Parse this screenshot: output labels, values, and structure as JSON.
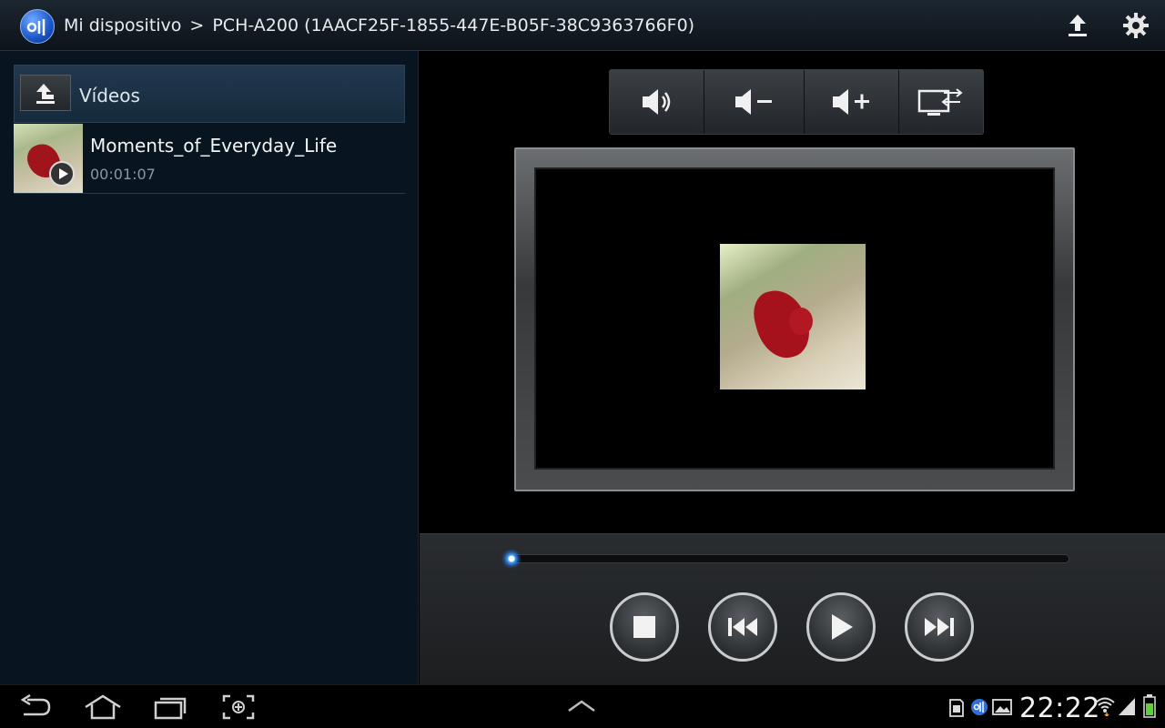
{
  "titlebar": {
    "breadcrumb_root": "Mi dispositivo",
    "breadcrumb_separator": ">",
    "breadcrumb_device": "PCH-A200 (1AACF25F-1855-447E-B05F-38C9363766F0)",
    "icons": [
      "app-logo",
      "upload-icon",
      "settings-gear-icon"
    ]
  },
  "browser": {
    "folder_title": "Vídeos",
    "items": [
      {
        "name": "Moments_of_Everyday_Life",
        "duration": "00:01:07"
      }
    ]
  },
  "renderer": {
    "volume_buttons": [
      "volume-icon",
      "volume-down-icon",
      "volume-up-icon",
      "switch-device-icon"
    ]
  },
  "playback": {
    "progress_fraction": 0.0,
    "controls": [
      "stop-icon",
      "previous-icon",
      "play-icon",
      "next-icon"
    ]
  },
  "statusbar": {
    "clock": "22:22",
    "icons": [
      "sd-card-icon",
      "allshare-icon",
      "gallery-icon",
      "wifi-icon",
      "signal-icon",
      "battery-icon"
    ]
  },
  "navbar": {
    "icons": [
      "back-icon",
      "home-icon",
      "recent-apps-icon",
      "screenshot-icon",
      "expand-icon"
    ]
  },
  "colors": {
    "accent": "#2b8cff",
    "panel_bg": "#081520",
    "header_bg": "#162a3c"
  }
}
